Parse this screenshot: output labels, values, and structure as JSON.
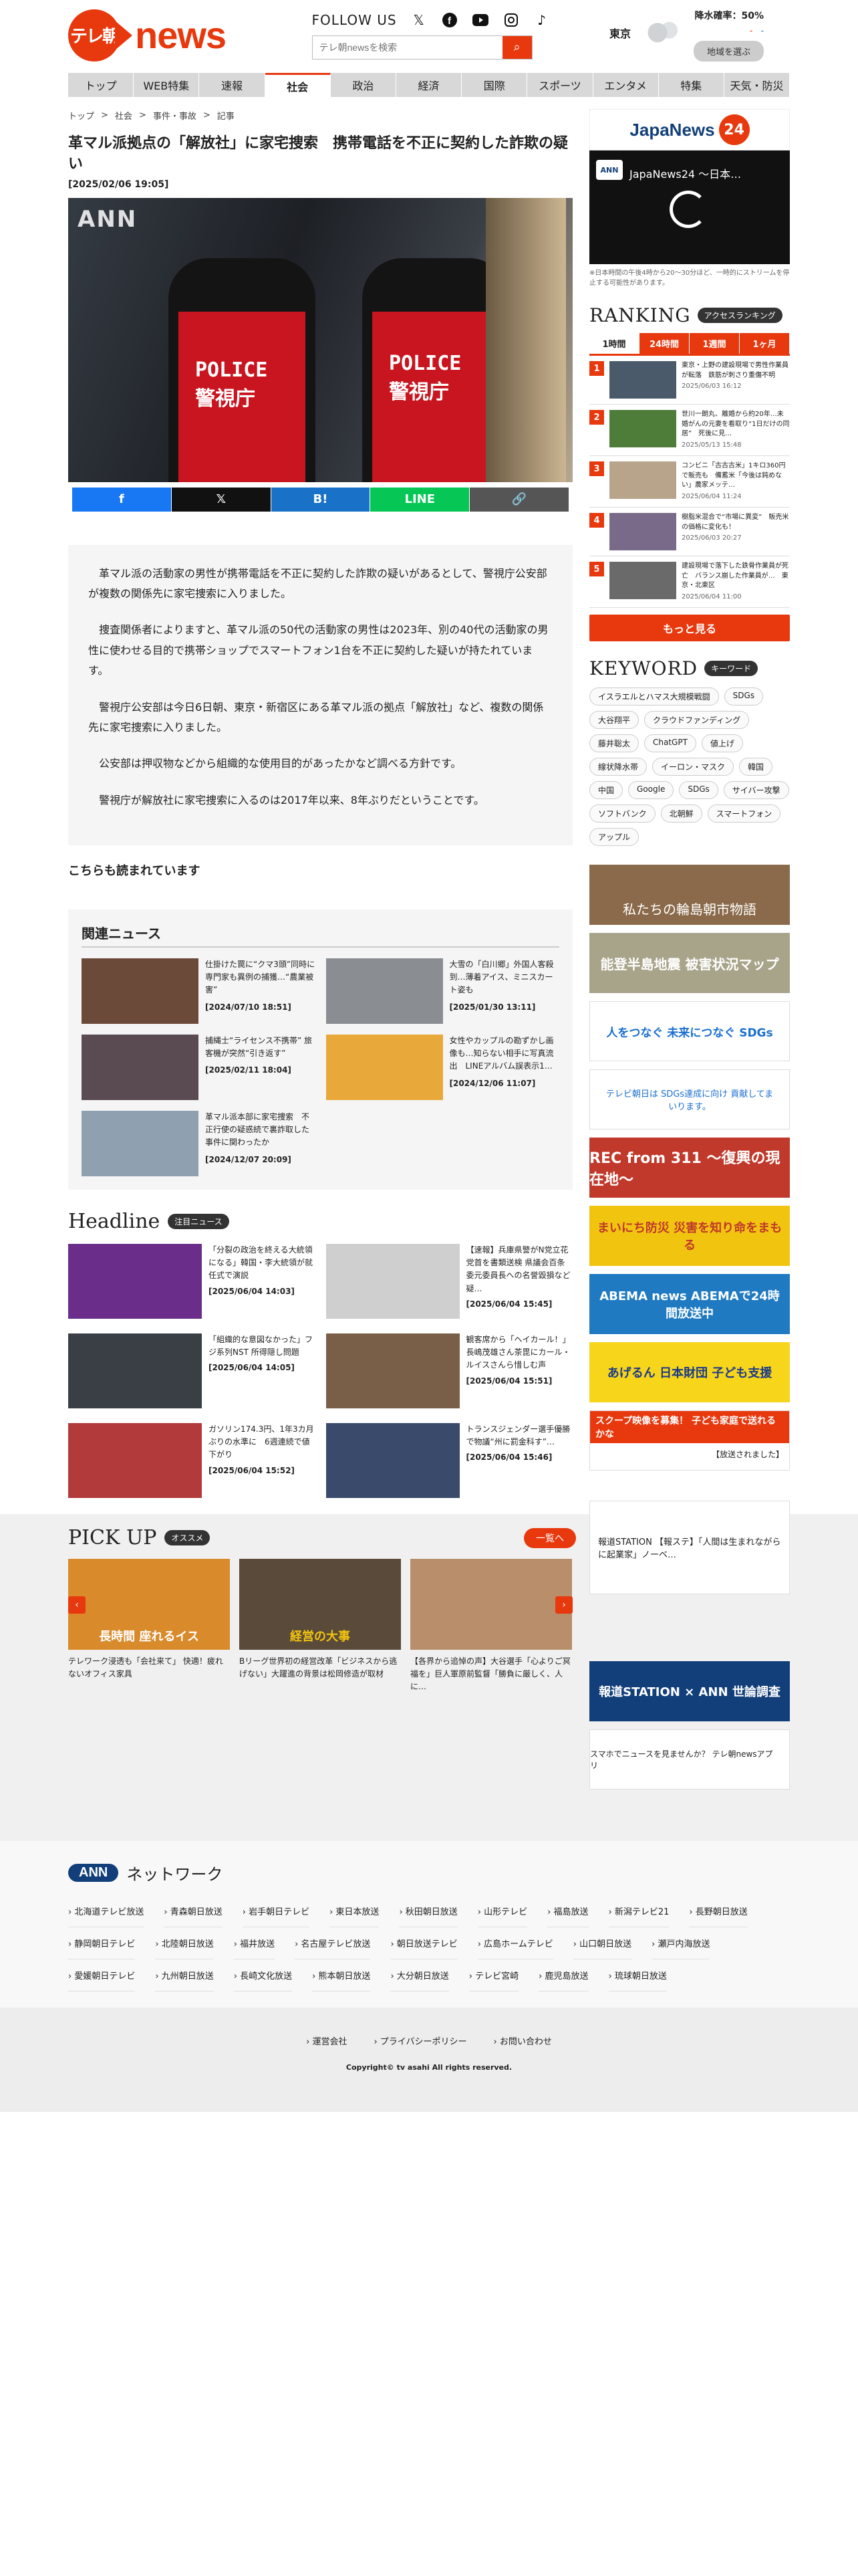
{
  "header": {
    "logo_badge": "テレ朝",
    "logo_word": "news",
    "follow_label": "FOLLOW US",
    "search_placeholder": "テレ朝newsを検索",
    "weather_city": "東京",
    "rain_prob": "降水確率：50%",
    "temp_hi": "-",
    "temp_lo": "-",
    "area_button": "地域を選ぶ"
  },
  "nav": [
    "トップ",
    "WEB特集",
    "速報",
    "社会",
    "政治",
    "経済",
    "国際",
    "スポーツ",
    "エンタメ",
    "特集",
    "天気・防災"
  ],
  "nav_active": "社会",
  "breadcrumb": [
    "トップ",
    "社会",
    "事件・事故",
    "記事"
  ],
  "article": {
    "title": "革マル派拠点の「解放社」に家宅捜索　携帯電話を不正に契約した詐欺の疑い",
    "date": "[2025/02/06 19:05]",
    "hero_watermark": "ANN",
    "hero_text_1": "POLICE",
    "hero_text_2": "警視庁",
    "share": [
      "f",
      "𝕏",
      "B!",
      "LINE",
      "🔗"
    ],
    "paragraphs": [
      "革マル派の活動家の男性が携帯電話を不正に契約した詐欺の疑いがあるとして、警視庁公安部が複数の関係先に家宅捜索に入りました。",
      "捜査関係者によりますと、革マル派の50代の活動家の男性は2023年、別の40代の活動家の男性に使わせる目的で携帯ショップでスマートフォン1台を不正に契約した疑いが持たれています。",
      "警視庁公安部は今日6日朝、東京・新宿区にある革マル派の拠点「解放社」など、複数の関係先に家宅捜索に入りました。",
      "公安部は押収物などから組織的な使用目的があったかなど調べる方針です。",
      "警視庁が解放社に家宅捜索に入るのは2017年以来、8年ぶりだということです。"
    ]
  },
  "also_read": "こちらも読まれています",
  "related": {
    "title": "関連ニュース",
    "items": [
      {
        "text": "仕掛けた罠に“クマ3頭”同時に　専門家も異例の捕獲…“農業被害”",
        "date": "[2024/07/10 18:51]",
        "color": "#6b4a3a"
      },
      {
        "text": "大雪の「白川郷」外国人客殺到…薄着アイス、ミニスカート姿も",
        "date": "[2025/01/30 13:11]",
        "color": "#8a8e92"
      },
      {
        "text": "捕縄士“ライセンス不携帯” 旅客機が突然“引き返す”",
        "date": "[2025/02/11 18:04]",
        "color": "#5a4a52"
      },
      {
        "text": "女性やカップルの勘ずかし画像も…知らない相手に写真流出　LINEアルバム誤表示1…",
        "date": "[2024/12/06 11:07]",
        "color": "#e8a93a"
      },
      {
        "text": "革マル派本部に家宅捜索　不正行使の疑惑続で裏詐取した事件に関わったか",
        "date": "[2024/12/07 20:09]",
        "color": "#8fa0b0"
      }
    ]
  },
  "headline": {
    "title": "Headline",
    "badge": "注目ニュース",
    "items": [
      {
        "text": "「分裂の政治を終える大統領になる」韓国・李大統領が就任式で演説",
        "date": "[2025/06/04 14:03]",
        "color": "#6a2e8a"
      },
      {
        "text": "【速報】兵庫県警がN党立花党首を書類送検 県議会百条委元委員長への名誉毀損など疑…",
        "date": "[2025/06/04 15:45]",
        "color": "#cfcfcf"
      },
      {
        "text": "「組織的な意図なかった」フジ系列NST 所得隠し問題",
        "date": "[2025/06/04 14:05]",
        "color": "#3a3f46"
      },
      {
        "text": "観客席から「ヘイカール！」長嶋茂雄さん茶毘にカール・ルイスさんら惜しむ声",
        "date": "[2025/06/04 15:51]",
        "color": "#7a5f48"
      },
      {
        "text": "ガソリン174.3円、1年3カ月ぶりの水準に　6週連続で値下がり",
        "date": "[2025/06/04 15:52]",
        "color": "#b23a3a"
      },
      {
        "text": "トランスジェンダー選手優勝で物議“州に罰金科す”…",
        "date": "[2025/06/04 15:46]",
        "color": "#3a4a6a"
      }
    ]
  },
  "pickup": {
    "title": "PICK UP",
    "badge": "オススメ",
    "list_button": "一覧へ",
    "items": [
      {
        "text": "テレワーク浸透も「会社来て」 快適！疲れないオフィス家具",
        "overlay": "長時間 座れるイス",
        "color": "#d98a2b"
      },
      {
        "text": "Bリーグ世界初の経営改革「ビジネスから逃げない」大躍進の背景は松岡修造が取材",
        "overlay": "経営の大事",
        "color": "#5a4a3a"
      },
      {
        "text": "【各界から追悼の声】大谷選手「心よりご冥福を」巨人軍原前監督「勝負に厳しく、人に…",
        "overlay": "",
        "color": "#b88f6a"
      }
    ]
  },
  "sidebar": {
    "jn_word": "JapaNews",
    "jn_24": "24",
    "video_title": "JapaNews24 ～日本…",
    "video_logo": "ANN",
    "video_note": "※日本時間の午後4時から20～30分ほど、一時的にストリームを停止する可能性があります。",
    "ranking_title": "RANKING",
    "ranking_badge": "アクセスランキング",
    "ranking_tabs": [
      "1時間",
      "24時間",
      "1週間",
      "1ヶ月"
    ],
    "ranking": [
      {
        "no": "1",
        "text": "東京・上野の建設現場で男性作業員が転落　鉄筋が刺さり重傷不明",
        "date": "2025/06/03 16:12",
        "color": "#4a5a6a"
      },
      {
        "text": "世川一朗丸、離婚から約20年…未婚がんの元妻を看取り“1日だけの同居”　死後に見…",
        "no": "2",
        "date": "2025/05/13 15:48",
        "color": "#4e7d3a"
      },
      {
        "no": "3",
        "text": "コンビニ「古古古米」1キロ360円で販売も　備蓄米「今後は鈍めない」農家メッテ…",
        "date": "2025/06/04 11:24",
        "color": "#b8a48a"
      },
      {
        "no": "4",
        "text": "樹脂米混合で“市場に異変”　販売米の価格に変化も！",
        "date": "2025/06/03 20:27",
        "color": "#7a6a8a"
      },
      {
        "no": "5",
        "text": "建設現場で落下した鉄骨作業員が死亡　バランス崩した作業員が…　東京・北東区",
        "date": "2025/06/04 11:00",
        "color": "#6a6a6a"
      }
    ],
    "more": "もっと見る",
    "keyword_title": "KEYWORD",
    "keyword_badge": "キーワード",
    "keywords": [
      "イスラエルとハマス大規模戦闘",
      "SDGs",
      "大谷翔平",
      "クラウドファンディング",
      "藤井聡太",
      "ChatGPT",
      "値上げ",
      "線状降水帯",
      "イーロン・マスク",
      "韓国",
      "中国",
      "Google",
      "SDGs",
      "サイバー攻撃",
      "ソフトバンク",
      "北朝鮮",
      "スマートフォン",
      "アップル"
    ],
    "banners": [
      {
        "label": "私たちの輪島朝市物語",
        "bg": "#8a6a4a",
        "fg": "#ffffff"
      },
      {
        "label": "能登半島地震 被害状況マップ",
        "bg": "#a8a48a",
        "fg": "#ffffff"
      },
      {
        "label": "人をつなぐ 未来につなぐ SDGs",
        "bg": "#ffffff",
        "fg": "#1a6fd0"
      },
      {
        "label": "テレビ朝日は SDGs達成に向け 貢献してまいります。",
        "bg": "#ffffff",
        "fg": "#1a6fd0"
      },
      {
        "label": "REC from 311 ～復興の現在地～",
        "bg": "#c0392b",
        "fg": "#ffffff"
      },
      {
        "label": "まいにち防災 災害を知り命をまもる",
        "bg": "#f1c40f",
        "fg": "#c0392b"
      },
      {
        "label": "ABEMA news ABEMAで24時間放送中",
        "bg": "#1f7ac2",
        "fg": "#ffffff"
      },
      {
        "label": "あげるん 日本財団 子ども支援",
        "bg": "#f7d51b",
        "fg": "#1a3a8a"
      },
      {
        "label": "スクープ映像を募集！ 子ども家庭で送れるかな",
        "bg": "#e8380d",
        "fg": "#ffffff"
      },
      {
        "label": "報道STATION 【報ステ】「人間は生まれながらに起業家」ノーベ…",
        "bg": "#ffffff",
        "fg": "#222222"
      },
      {
        "label": "報道STATION × ANN 世論調査",
        "bg": "#123f7a",
        "fg": "#ffffff"
      },
      {
        "label": "スマホでニュースを見ませんか？ テレ朝newsアプリ",
        "bg": "#ffffff",
        "fg": "#222222"
      }
    ],
    "side_card_caption": "【放送されました】"
  },
  "footer": {
    "ann": "ANN",
    "net_title": "ネットワーク",
    "stations": [
      "北海道テレビ放送",
      "青森朝日放送",
      "岩手朝日テレビ",
      "東日本放送",
      "秋田朝日放送",
      "山形テレビ",
      "福島放送",
      "新潟テレビ21",
      "長野朝日放送",
      "静岡朝日テレビ",
      "北陸朝日放送",
      "福井放送",
      "名古屋テレビ放送",
      "朝日放送テレビ",
      "広島ホームテレビ",
      "山口朝日放送",
      "瀬戸内海放送",
      "愛媛朝日テレビ",
      "九州朝日放送",
      "長崎文化放送",
      "熊本朝日放送",
      "大分朝日放送",
      "テレビ宮崎",
      "鹿児島放送",
      "琉球朝日放送"
    ],
    "links": [
      "運営会社",
      "プライバシーポリシー",
      "お問い合わせ"
    ],
    "copyright": "Copyright© tv asahi All rights reserved."
  }
}
